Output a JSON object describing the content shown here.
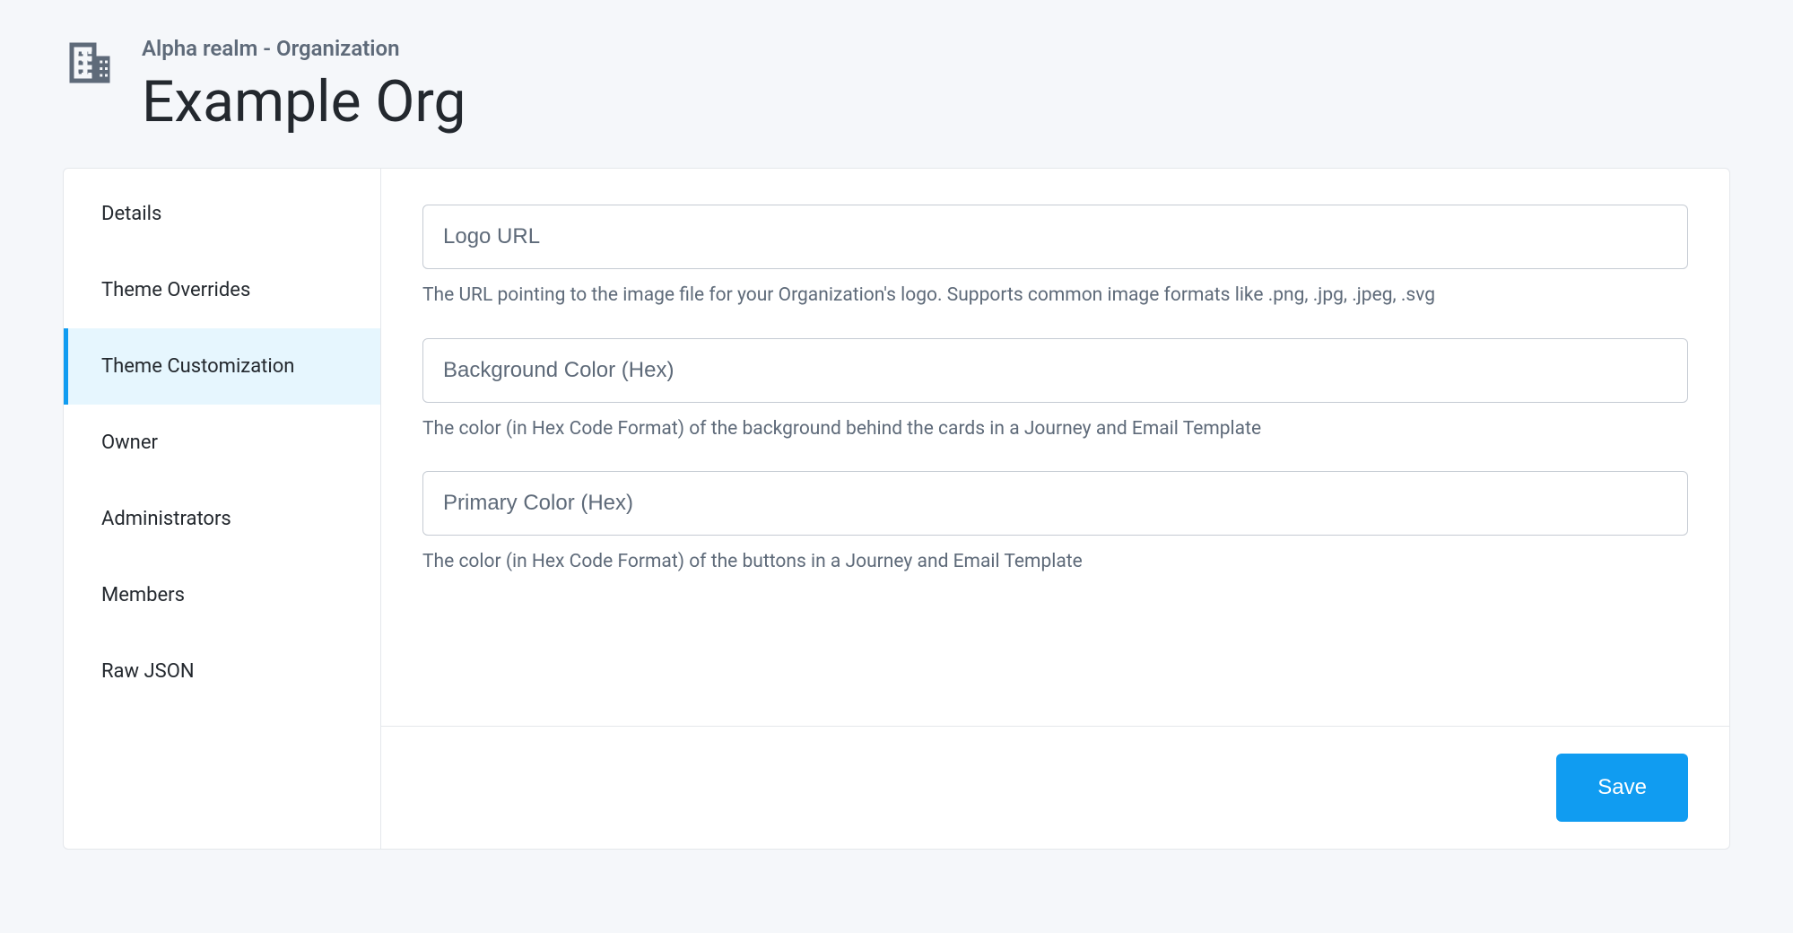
{
  "header": {
    "breadcrumb": "Alpha realm - Organization",
    "title": "Example Org"
  },
  "sidebar": {
    "items": [
      {
        "label": "Details",
        "active": false
      },
      {
        "label": "Theme Overrides",
        "active": false
      },
      {
        "label": "Theme Customization",
        "active": true
      },
      {
        "label": "Owner",
        "active": false
      },
      {
        "label": "Administrators",
        "active": false
      },
      {
        "label": "Members",
        "active": false
      },
      {
        "label": "Raw JSON",
        "active": false
      }
    ]
  },
  "form": {
    "fields": [
      {
        "placeholder": "Logo URL",
        "value": "",
        "helper": "The URL pointing to the image file for your Organization's logo. Supports common image formats like .png, .jpg, .jpeg, .svg"
      },
      {
        "placeholder": "Background Color (Hex)",
        "value": "",
        "helper": "The color (in Hex Code Format) of the background behind the cards in a Journey and Email Template"
      },
      {
        "placeholder": "Primary Color (Hex)",
        "value": "",
        "helper": "The color (in Hex Code Format) of the buttons in a Journey and Email Template"
      }
    ]
  },
  "footer": {
    "save_label": "Save"
  }
}
